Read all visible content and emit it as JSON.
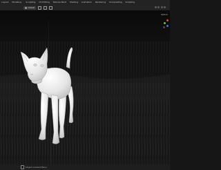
{
  "workspace_tabs": [
    "Layout",
    "Modeling",
    "Sculpting",
    "UV Editing",
    "Texture Paint",
    "Shading",
    "Animation",
    "Rendering",
    "Compositing",
    "Scripting"
  ],
  "viewport_header": {
    "transform_orientation": "Global"
  },
  "viewport": {
    "corner_label": "Option"
  },
  "status_bar": {
    "context_hint": "Object Context Menu"
  },
  "colors": {
    "background": "#111111",
    "model_fill": "#e8e8e8",
    "gizmo_x": "#e04a4a",
    "gizmo_y": "#6fbf3e",
    "gizmo_z": "#3f7ad8"
  },
  "icons": [
    "mouse-icon",
    "navigation-gizmo"
  ]
}
